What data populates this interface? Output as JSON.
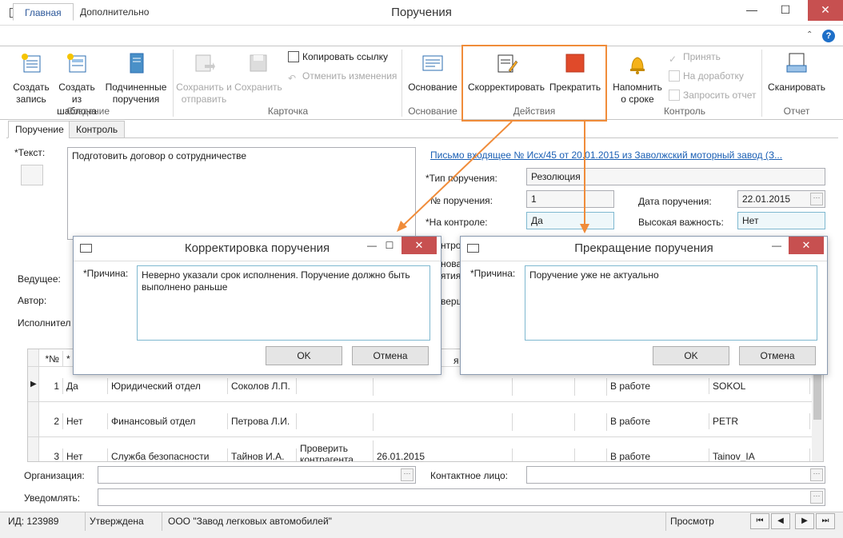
{
  "window": {
    "title": "Поручения",
    "controls": {
      "minimize": "—",
      "maximize": "☐",
      "close": "✕"
    }
  },
  "ribbon_tabs": [
    {
      "label": "Главная"
    },
    {
      "label": "Дополнительно"
    }
  ],
  "ribbon": {
    "groups": {
      "create": {
        "label": "Создание",
        "buttons": [
          {
            "label": "Создать запись",
            "icon": "new-record-icon"
          },
          {
            "label": "Создать из шаблона",
            "icon": "template-icon"
          },
          {
            "label": "Подчиненные поручения",
            "icon": "subtasks-icon"
          }
        ]
      },
      "card": {
        "label": "Карточка",
        "buttons": [
          {
            "label": "Сохранить и отправить",
            "icon": "save-send-icon",
            "disabled": true
          },
          {
            "label": "Сохранить",
            "icon": "save-icon",
            "disabled": true
          }
        ],
        "small": [
          {
            "label": "Копировать ссылку",
            "icon": "copy-link-icon"
          },
          {
            "label": "Отменить изменения",
            "icon": "undo-icon",
            "disabled": true
          }
        ]
      },
      "basis": {
        "label": "Основание",
        "buttons": [
          {
            "label": "Основание",
            "icon": "basis-icon"
          }
        ]
      },
      "actions": {
        "label": "Действия",
        "buttons": [
          {
            "label": "Скорректировать",
            "icon": "edit-icon"
          },
          {
            "label": "Прекратить",
            "icon": "stop-icon"
          }
        ]
      },
      "control": {
        "label": "Контроль",
        "buttons": [
          {
            "label": "Напомнить о сроке",
            "icon": "bell-icon"
          }
        ],
        "small": [
          {
            "label": "Принять",
            "icon": "check-icon",
            "disabled": true
          },
          {
            "label": "На доработку",
            "icon": "rework-icon",
            "disabled": true
          },
          {
            "label": "Запросить отчет",
            "icon": "report-icon",
            "disabled": true
          }
        ]
      },
      "report": {
        "label": "Отчет",
        "buttons": [
          {
            "label": "Сканировать",
            "icon": "scan-icon"
          }
        ]
      }
    }
  },
  "form_tabs": [
    {
      "label": "Поручение"
    },
    {
      "label": "Контроль"
    }
  ],
  "form": {
    "text_label": "*Текст:",
    "text_value": "Подготовить договор о сотрудничестве",
    "basis_link": "Письмо входящее № Исх/45 от 20.01.2015 из Заволжский моторный завод (З...",
    "type_label": "*Тип поручения:",
    "type_value": "Резолюция",
    "number_label": "№ поручения:",
    "number_value": "1",
    "date_label": "Дата поручения:",
    "date_value": "22.01.2015",
    "control_label": "*На контроле:",
    "control_value": "Да",
    "importance_label": "Высокая важность:",
    "importance_value": "Нет",
    "lead_label": "Ведущее:",
    "author_label": "Автор:",
    "executors_label": "Исполнител",
    "hidden_labels": [
      "нтро",
      "нова",
      "ятия",
      "верш"
    ],
    "org_label": "Организация:",
    "contact_label": "Контактное лицо:",
    "notify_label": "Уведомлять:"
  },
  "grid": {
    "headers": [
      "*№",
      "*"
    ],
    "rows": [
      {
        "num": "1",
        "main": "Да",
        "dept": "Юридический отдел",
        "person": "Соколов Л.П.",
        "task": "",
        "date": "",
        "status": "В работе",
        "login": "SOKOL"
      },
      {
        "num": "2",
        "main": "Нет",
        "dept": "Финансовый отдел",
        "person": "Петрова Л.И.",
        "task": "",
        "date": "",
        "status": "В работе",
        "login": "PETR"
      },
      {
        "num": "3",
        "main": "Нет",
        "dept": "Служба безопасности",
        "person": "Тайнов И.А.",
        "task": "Проверить контрагента",
        "date": "26.01.2015",
        "status": "В работе",
        "login": "Tainov_IA"
      }
    ],
    "hidden_header": "я"
  },
  "dialog_correct": {
    "title": "Корректировка поручения",
    "reason_label": "*Причина:",
    "reason_value": "Неверно указали срок исполнения. Поручение должно быть выполнено раньше",
    "ok": "OK",
    "cancel": "Отмена"
  },
  "dialog_stop": {
    "title": "Прекращение поручения",
    "reason_label": "*Причина:",
    "reason_value": "Поручение уже не актуально",
    "ok": "OK",
    "cancel": "Отмена"
  },
  "status": {
    "id": "ИД: 123989",
    "state": "Утверждена",
    "org": "ООО \"Завод легковых автомобилей\"",
    "mode": "Просмотр",
    "nav": [
      "⏮",
      "◀",
      "▶",
      "⏭"
    ]
  },
  "colors": {
    "accent": "#2b579a",
    "highlight": "#f08c3a",
    "close": "#c75050"
  }
}
